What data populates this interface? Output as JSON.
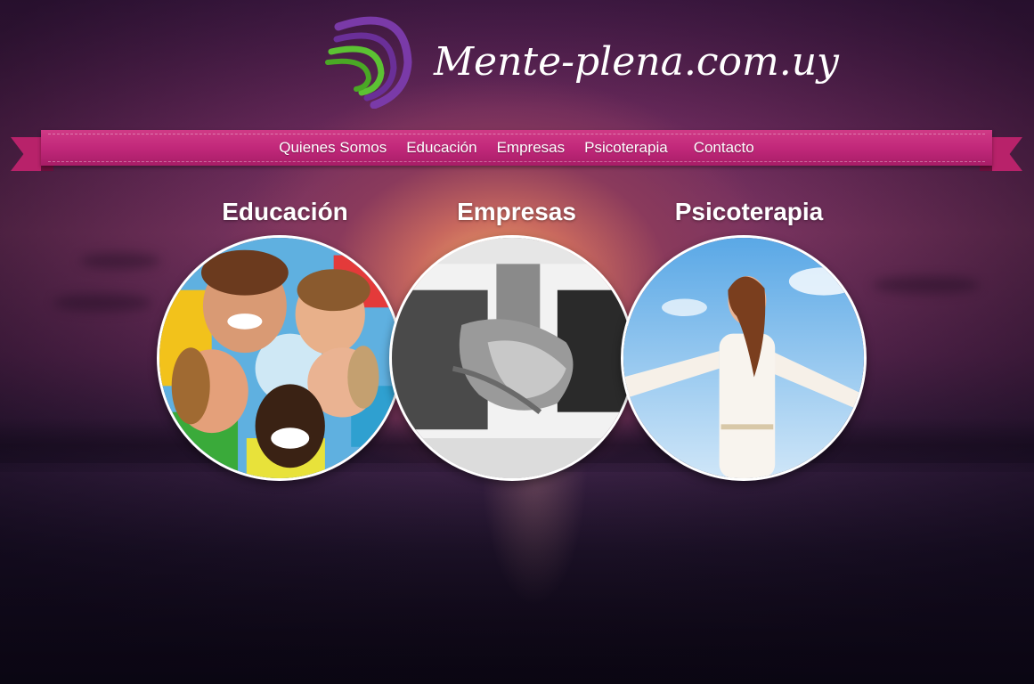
{
  "header": {
    "site_title": "Mente-plena.com.uy",
    "logo_icon": "arcs-logo-icon",
    "logo_colors": [
      "#7a3aa8",
      "#5cc233"
    ]
  },
  "nav": {
    "items": [
      {
        "label": "Quienes Somos"
      },
      {
        "label": "Educación"
      },
      {
        "label": "Empresas"
      },
      {
        "label": "Psicoterapia"
      },
      {
        "label": "Contacto"
      }
    ],
    "ribbon_color": "#c1287a"
  },
  "sections": [
    {
      "title": "Educación",
      "image": "children-circle-photo"
    },
    {
      "title": "Empresas",
      "image": "handshake-photo"
    },
    {
      "title": "Psicoterapia",
      "image": "woman-breathing-photo"
    }
  ]
}
